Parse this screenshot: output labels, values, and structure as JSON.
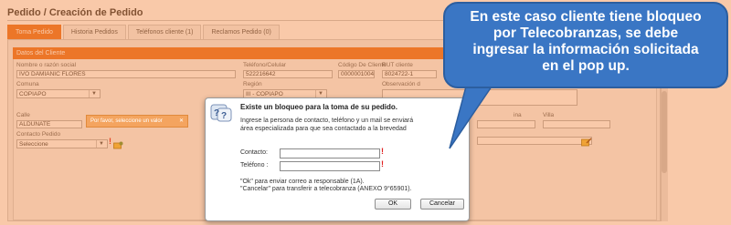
{
  "page": {
    "title": "Pedido / Creación de Pedido"
  },
  "tabs": [
    {
      "label": "Toma Pedido",
      "active": true
    },
    {
      "label": "Historia Pedidos",
      "active": false
    },
    {
      "label": "Teléfonos cliente (1)",
      "active": false
    },
    {
      "label": "Reclamos Pedido (0)",
      "active": false
    }
  ],
  "section": {
    "header": "Datos del Cliente"
  },
  "form": {
    "name_label": "Nombre o razón social",
    "name_value": "IVO DAMIANIC FLORES",
    "phone_label": "Teléfono/Celular",
    "phone_value": "522216642",
    "code_label": "Código De Cliente",
    "code_value": "0000001004",
    "rut_label": "RUT cliente",
    "rut_value": "8024722-1",
    "comuna_label": "Comuna",
    "comuna_value": "COPIAPO",
    "region_label": "Región",
    "region_value": "III - COPIAPO",
    "obs_label": "Observación d",
    "calle_label": "Calle",
    "calle_value": "ALDUNATE",
    "depto_label": "ina",
    "villa_label": "Villa",
    "contact_label": "Contacto Pedido",
    "contact_value": "Seleccione",
    "arrow": "▼"
  },
  "tooltip": {
    "text": "Por favor, seleccione un valor",
    "close": "✕"
  },
  "bubble": {
    "lines": [
      "En este caso cliente tiene bloqueo",
      "por Telecobranzas, se debe",
      "ingresar la información solicitada",
      "en el pop up."
    ]
  },
  "modal": {
    "title": "Existe un bloqueo para la toma de su pedido.",
    "text_line1": "Ingrese la persona de contacto, teléfono y un mail se enviará",
    "text_line2": "área especializada para que sea contactado a la brevedad",
    "contact_label": "Contacto:",
    "phone_label": "Teléfono :",
    "contact_value": "",
    "phone_value": "",
    "required_mark": "!",
    "note_line1": "\"Ok\" para enviar correo a responsable (1A).",
    "note_line2": "\"Cancelar\" para transferir a telecobranza (ANEXO 9°65901).",
    "ok_label": "OK",
    "cancel_label": "Cancelar"
  },
  "colors": {
    "accent": "#e97528",
    "bubble": "#3a76c4"
  }
}
